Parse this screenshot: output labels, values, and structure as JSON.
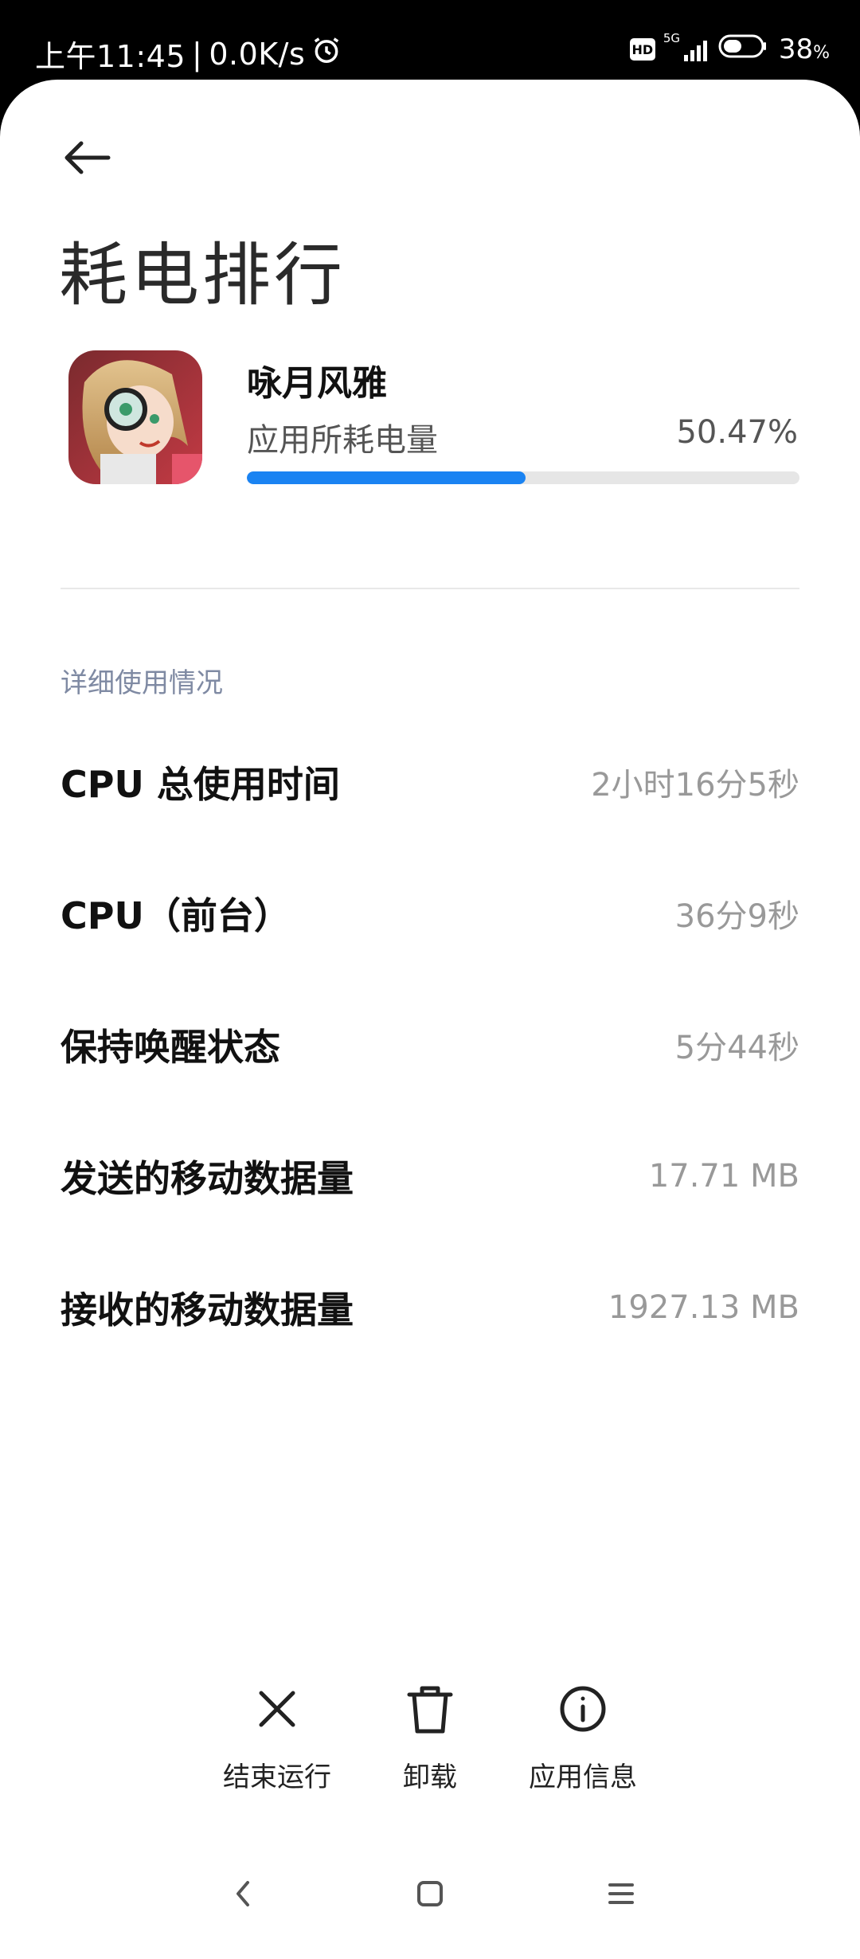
{
  "status_bar": {
    "time": "上午11:45",
    "net_speed": "0.0K/s",
    "network": "5G",
    "hd": "HD",
    "battery": "38"
  },
  "page": {
    "title": "耗电排行"
  },
  "app": {
    "name": "咏月风雅",
    "usage_label": "应用所耗电量",
    "usage_value": "50.47%",
    "usage_fraction": 0.5047
  },
  "details": {
    "section_label": "详细使用情况",
    "rows": [
      {
        "label": "CPU 总使用时间",
        "value": "2小时16分5秒"
      },
      {
        "label": "CPU（前台）",
        "value": "36分9秒"
      },
      {
        "label": "保持唤醒状态",
        "value": "5分44秒"
      },
      {
        "label": "发送的移动数据量",
        "value": "17.71 MB"
      },
      {
        "label": "接收的移动数据量",
        "value": "1927.13 MB"
      }
    ]
  },
  "actions": {
    "force_stop": "结束运行",
    "uninstall": "卸载",
    "app_info": "应用信息"
  },
  "colors": {
    "accent": "#1a83f2",
    "section_label": "#7f8aa3"
  }
}
